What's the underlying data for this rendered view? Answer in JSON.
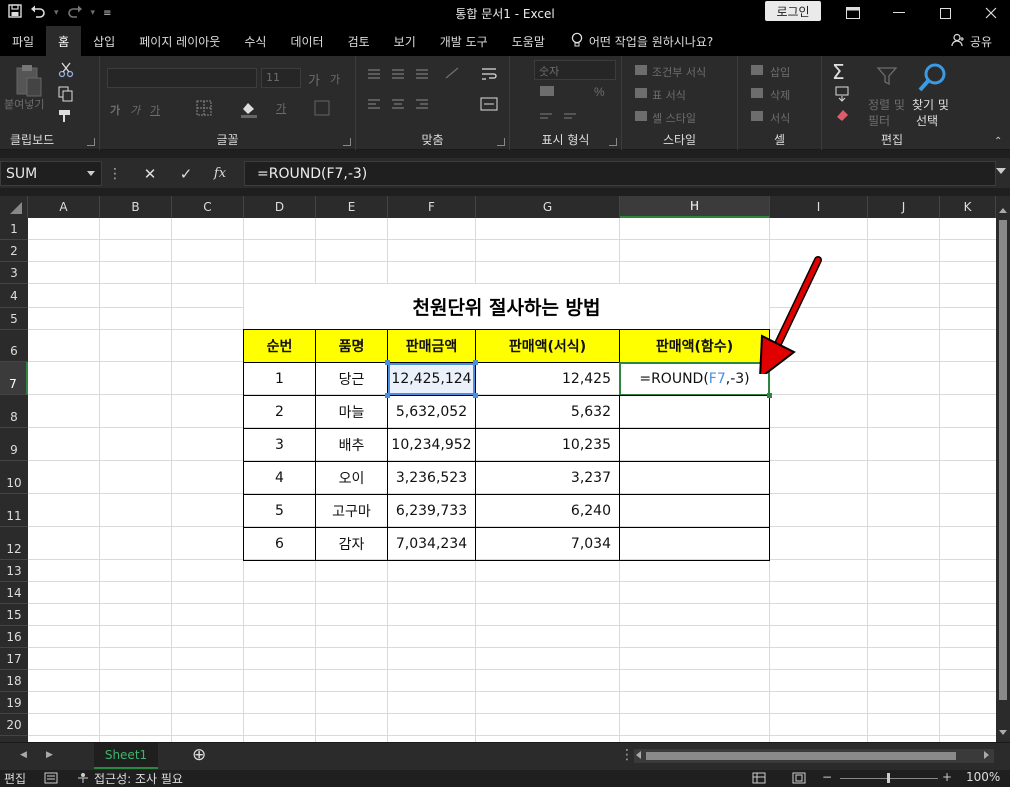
{
  "titlebar": {
    "title": "통합 문서1  -  Excel",
    "login": "로그인",
    "qa_icons": [
      "save-icon",
      "undo-icon",
      "redo-icon",
      "customize-icon"
    ]
  },
  "menu": {
    "tabs": [
      "파일",
      "홈",
      "삽입",
      "페이지 레이아웃",
      "수식",
      "데이터",
      "검토",
      "보기",
      "개발 도구",
      "도움말"
    ],
    "active": "홈",
    "tellme": "어떤 작업을 원하시나요?",
    "share": "공유"
  },
  "ribbon": {
    "clipboard": {
      "label": "클립보드",
      "paste": "붙여넣기"
    },
    "font": {
      "label": "글꼴",
      "size": "11",
      "grow": "가",
      "shrink": "가",
      "bold": "가",
      "italic": "가",
      "underline": "가",
      "fontcolor": "가"
    },
    "align": {
      "label": "맞춤"
    },
    "number": {
      "label": "표시 형식",
      "format": "숫자"
    },
    "styles": {
      "label": "스타일",
      "cond": "조건부 서식",
      "table": "표 서식",
      "cell": "셀 스타일"
    },
    "cells": {
      "label": "셀",
      "insert": "삽입",
      "delete": "삭제",
      "format": "서식"
    },
    "editing": {
      "label": "편집",
      "sort1": "정렬 및",
      "sort2": "필터",
      "find1": "찾기 및",
      "find2": "선택"
    }
  },
  "formula_bar": {
    "name_box": "SUM",
    "cancel": "✕",
    "enter": "✓",
    "fx": "fx",
    "formula": "=ROUND(F7,-3)"
  },
  "columns": [
    "A",
    "B",
    "C",
    "D",
    "E",
    "F",
    "G",
    "H",
    "I",
    "J",
    "K"
  ],
  "rows": [
    "1",
    "2",
    "3",
    "4",
    "5",
    "6",
    "7",
    "8",
    "9",
    "10",
    "11",
    "12",
    "13",
    "14",
    "15",
    "16",
    "17",
    "18",
    "19",
    "20"
  ],
  "sheet": {
    "title": "천원단위 절사하는 방법",
    "headers": [
      "순번",
      "품명",
      "판매금액",
      "판매액(서식)",
      "판매액(함수)"
    ],
    "data": [
      {
        "no": "1",
        "name": "당근",
        "amount": "12,425,124",
        "fmt": "12,425"
      },
      {
        "no": "2",
        "name": "마늘",
        "amount": "5,632,052",
        "fmt": "5,632"
      },
      {
        "no": "3",
        "name": "배추",
        "amount": "10,234,952",
        "fmt": "10,235"
      },
      {
        "no": "4",
        "name": "오이",
        "amount": "3,236,523",
        "fmt": "3,237"
      },
      {
        "no": "5",
        "name": "고구마",
        "amount": "6,239,733",
        "fmt": "6,240"
      },
      {
        "no": "6",
        "name": "감자",
        "amount": "7,034,234",
        "fmt": "7,034"
      }
    ],
    "edit_cell": {
      "prefix": "=ROUND(",
      "ref": "F7",
      "suffix": ",-3)"
    }
  },
  "sheet_tabs": {
    "active": "Sheet1",
    "add": "⊕"
  },
  "status": {
    "mode": "편집",
    "accessibility": "접근성: 조사 필요",
    "zoom": "100%"
  },
  "colors": {
    "header_fill": "#FFFF00",
    "ref_blue": "#4a90e2",
    "accent_green": "#2e8540",
    "arrow_red": "#e00000"
  }
}
